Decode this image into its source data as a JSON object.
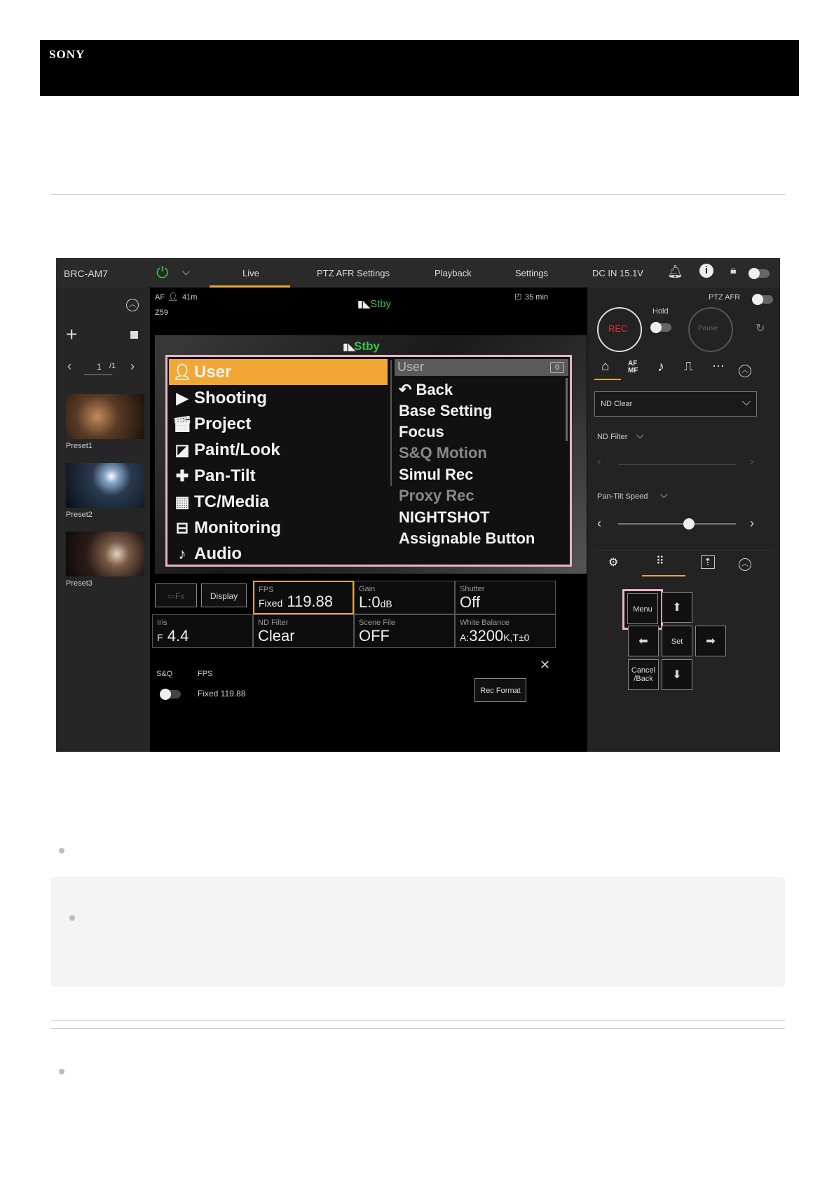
{
  "brand": {
    "logo": "SONY"
  },
  "app": {
    "device": "BRC-AM7",
    "tabs": [
      "Live",
      "PTZ AFR Settings",
      "Playback",
      "Settings"
    ],
    "power_status": "DC IN 15.1V",
    "left": {
      "page": "1",
      "page_total": "/1",
      "presets": [
        "Preset1",
        "Preset2",
        "Preset3"
      ]
    },
    "overlay": {
      "af": "AF",
      "distance": "41m",
      "zoom": "Z59",
      "status": "Stby",
      "status_inner": "Stby",
      "time": "35 min"
    },
    "menu": {
      "items": [
        {
          "icon": "user-icon",
          "label": "User"
        },
        {
          "icon": "camera-icon",
          "label": "Shooting"
        },
        {
          "icon": "clapper-icon",
          "label": "Project"
        },
        {
          "icon": "paint-icon",
          "label": "Paint/Look"
        },
        {
          "icon": "pan-tilt-icon",
          "label": "Pan-Tilt"
        },
        {
          "icon": "tc-media-icon",
          "label": "TC/Media"
        },
        {
          "icon": "monitor-out-icon",
          "label": "Monitoring"
        },
        {
          "icon": "audio-note-icon",
          "label": "Audio"
        }
      ],
      "sub_header": "User",
      "sub_count": "0",
      "sub_items": [
        {
          "label": "Back",
          "dim": false
        },
        {
          "label": "Base Setting",
          "dim": false
        },
        {
          "label": "Focus",
          "dim": false
        },
        {
          "label": "S&Q Motion",
          "dim": true
        },
        {
          "label": "Simul Rec",
          "dim": false
        },
        {
          "label": "Proxy Rec",
          "dim": true
        },
        {
          "label": "NIGHTSHOT",
          "dim": false
        },
        {
          "label": "Assignable Button",
          "dim": false
        }
      ]
    },
    "params": {
      "display_label": "Display",
      "fps": {
        "label": "FPS",
        "prefix": "Fixed",
        "value": "119.88"
      },
      "gain": {
        "label": "Gain",
        "value": "L:0",
        "unit": "dB"
      },
      "shutter": {
        "label": "Shutter",
        "value": "Off"
      },
      "iris": {
        "label": "Iris",
        "prefix": "F",
        "value": "4.4"
      },
      "nd": {
        "label": "ND Filter",
        "value": "Clear"
      },
      "scene": {
        "label": "Scene File",
        "value": "OFF"
      },
      "wb": {
        "label": "White Balance",
        "prefix": "A:",
        "value": "3200",
        "unit": "K,T±0"
      }
    },
    "sq": {
      "label": "S&Q",
      "fps_label": "FPS",
      "fps_value": "Fixed 119.88",
      "rec_format": "Rec Format"
    },
    "right": {
      "ptz_afr": "PTZ AFR",
      "hold": "Hold",
      "rec": "REC",
      "pause": "Pause",
      "nd_clear": "ND Clear",
      "nd_filter": "ND Filter",
      "pantilt_speed": "Pan-Tilt Speed",
      "pantilt_speed_level": 0.6,
      "menu_btn": "Menu",
      "set_btn": "Set",
      "cancel_line1": "Cancel",
      "cancel_line2": "/Back"
    }
  }
}
